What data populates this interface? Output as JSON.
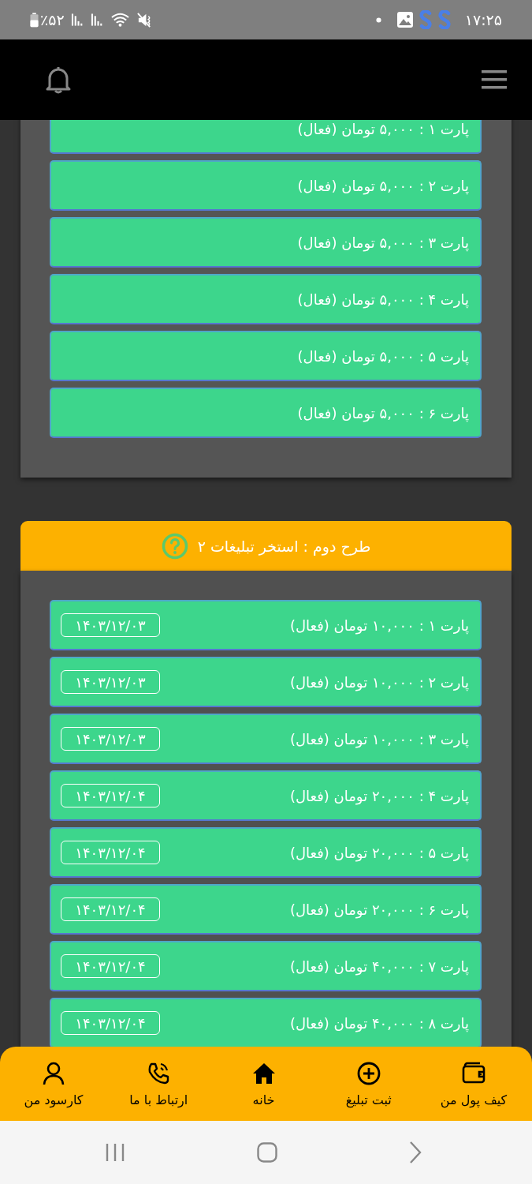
{
  "status_bar": {
    "time": "۱۷:۲۵",
    "battery": "٪۵۲"
  },
  "plans": [
    {
      "rows": [
        {
          "label": "پارت ۱ : ۵,۰۰۰ تومان (فعال)"
        },
        {
          "label": "پارت ۲ : ۵,۰۰۰ تومان (فعال)"
        },
        {
          "label": "پارت ۳ : ۵,۰۰۰ تومان (فعال)"
        },
        {
          "label": "پارت ۴ : ۵,۰۰۰ تومان (فعال)"
        },
        {
          "label": "پارت ۵ : ۵,۰۰۰ تومان (فعال)"
        },
        {
          "label": "پارت ۶ : ۵,۰۰۰ تومان (فعال)"
        }
      ]
    },
    {
      "title": "طرح دوم : استخر تبلیغات ۲",
      "rows": [
        {
          "label": "پارت ۱ : ۱۰,۰۰۰ تومان (فعال)",
          "date": "۱۴۰۳/۱۲/۰۳"
        },
        {
          "label": "پارت ۲ : ۱۰,۰۰۰ تومان (فعال)",
          "date": "۱۴۰۳/۱۲/۰۳"
        },
        {
          "label": "پارت ۳ : ۱۰,۰۰۰ تومان (فعال)",
          "date": "۱۴۰۳/۱۲/۰۳"
        },
        {
          "label": "پارت ۴ : ۲۰,۰۰۰ تومان (فعال)",
          "date": "۱۴۰۳/۱۲/۰۴"
        },
        {
          "label": "پارت ۵ : ۲۰,۰۰۰ تومان (فعال)",
          "date": "۱۴۰۳/۱۲/۰۴"
        },
        {
          "label": "پارت ۶ : ۲۰,۰۰۰ تومان (فعال)",
          "date": "۱۴۰۳/۱۲/۰۴"
        },
        {
          "label": "پارت ۷ : ۴۰,۰۰۰ تومان (فعال)",
          "date": "۱۴۰۳/۱۲/۰۴"
        },
        {
          "label": "پارت ۸ : ۴۰,۰۰۰ تومان (فعال)",
          "date": "۱۴۰۳/۱۲/۰۴"
        }
      ]
    }
  ],
  "bottom_nav": [
    {
      "label": "کیف پول من"
    },
    {
      "label": "ثبت تبلیغ"
    },
    {
      "label": "خانه"
    },
    {
      "label": "ارتباط با ما"
    },
    {
      "label": "کارسود من"
    }
  ]
}
